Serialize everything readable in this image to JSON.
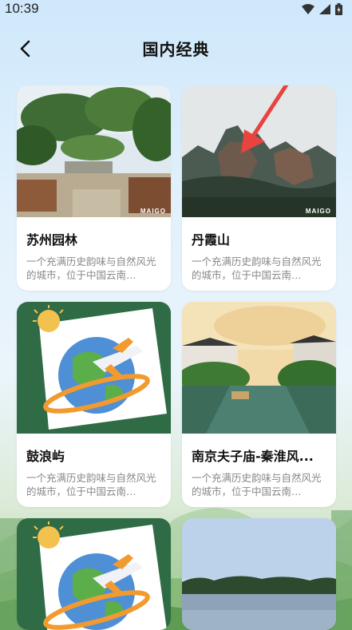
{
  "status": {
    "time": "10:39",
    "icons": [
      "wifi-icon",
      "cell-signal-icon",
      "battery-charging-icon"
    ]
  },
  "header": {
    "title": "国内经典",
    "back_icon": "chevron-left-icon"
  },
  "cards": [
    {
      "title": "苏州园林",
      "desc": "一个充满历史韵味与自然风光的城市，位于中国云南…",
      "watermark": "MAIGO",
      "image": "garden-photo"
    },
    {
      "title": "丹霞山",
      "desc": "一个充满历史韵味与自然风光的城市，位于中国云南…",
      "watermark": "MAIGO",
      "image": "danxia-mountain-photo"
    },
    {
      "title": "鼓浪屿",
      "desc": "一个充满历史韵味与自然风光的城市，位于中国云南…",
      "image": "globe-plane-illustration"
    },
    {
      "title": "南京夫子庙-秦淮风...",
      "desc": "一个充满历史韵味与自然风光的城市，位于中国云南…",
      "image": "qinhuai-river-photo"
    },
    {
      "title": "",
      "desc": "",
      "image": "globe-plane-illustration"
    },
    {
      "title": "",
      "desc": "",
      "image": "lake-photo"
    }
  ],
  "colors": {
    "accent": "#e8433f",
    "card_bg": "#ffffff",
    "title": "#111111",
    "desc": "#888888",
    "illustration_bg": "#2f6b45"
  }
}
